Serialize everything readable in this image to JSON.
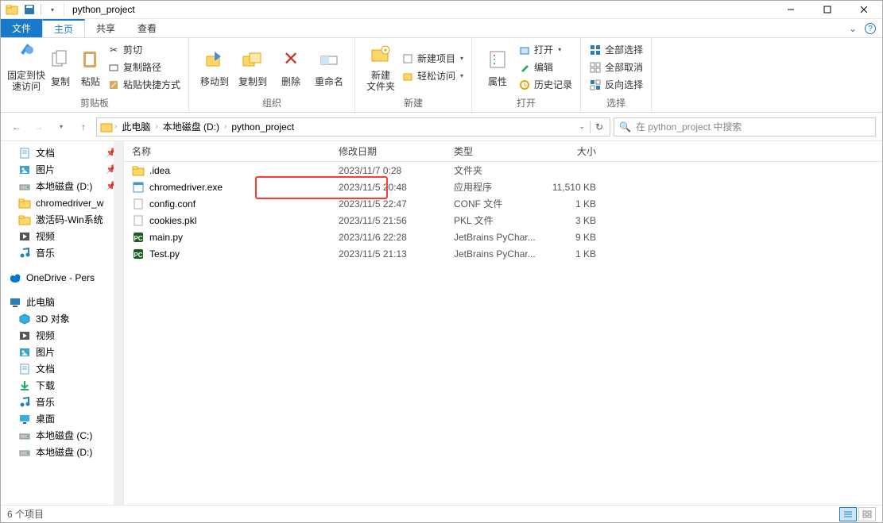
{
  "window": {
    "title": "python_project"
  },
  "qat": {
    "items": [
      "folder-icon",
      "save-icon",
      "divider",
      "chevron-down"
    ]
  },
  "tabs": {
    "file": "文件",
    "home": "主页",
    "share": "共享",
    "view": "查看"
  },
  "ribbon": {
    "clipboard": {
      "label": "剪贴板",
      "pin": "固定到快\n速访问",
      "copy": "复制",
      "paste": "粘贴",
      "cut": "剪切",
      "copy_path": "复制路径",
      "paste_shortcut": "粘贴快捷方式"
    },
    "organize": {
      "label": "组织",
      "move_to": "移动到",
      "copy_to": "复制到",
      "delete": "删除",
      "rename": "重命名"
    },
    "new": {
      "label": "新建",
      "new_folder": "新建\n文件夹",
      "new_item": "新建项目",
      "easy_access": "轻松访问"
    },
    "open": {
      "label": "打开",
      "properties": "属性",
      "open": "打开",
      "edit": "编辑",
      "history": "历史记录"
    },
    "select": {
      "label": "选择",
      "select_all": "全部选择",
      "select_none": "全部取消",
      "invert": "反向选择"
    }
  },
  "breadcrumb": [
    "此电脑",
    "本地磁盘 (D:)",
    "python_project"
  ],
  "addressbar": {
    "refresh": "refresh"
  },
  "search": {
    "placeholder": "在 python_project 中搜索"
  },
  "columns": {
    "name": "名称",
    "date": "修改日期",
    "type": "类型",
    "size": "大小"
  },
  "sidebar_quick": [
    {
      "icon": "doc",
      "label": "文档",
      "pin": true
    },
    {
      "icon": "pic",
      "label": "图片",
      "pin": true
    },
    {
      "icon": "drive",
      "label": "本地磁盘 (D:)",
      "pin": true
    },
    {
      "icon": "folder",
      "label": "chromedriver_w",
      "pin": false
    },
    {
      "icon": "folder",
      "label": "激活码-Win系统",
      "pin": false
    },
    {
      "icon": "video",
      "label": "视频",
      "pin": false
    },
    {
      "icon": "music",
      "label": "音乐",
      "pin": false
    }
  ],
  "sidebar_onedrive": {
    "label": "OneDrive - Pers"
  },
  "sidebar_pc": {
    "label": "此电脑"
  },
  "sidebar_pc_children": [
    {
      "icon": "3d",
      "label": "3D 对象"
    },
    {
      "icon": "video",
      "label": "视频"
    },
    {
      "icon": "pic",
      "label": "图片"
    },
    {
      "icon": "doc",
      "label": "文档"
    },
    {
      "icon": "download",
      "label": "下载"
    },
    {
      "icon": "music",
      "label": "音乐"
    },
    {
      "icon": "desktop",
      "label": "桌面"
    },
    {
      "icon": "drive",
      "label": "本地磁盘 (C:)"
    },
    {
      "icon": "drive",
      "label": "本地磁盘 (D:)"
    }
  ],
  "files": [
    {
      "icon": "folder",
      "name": ".idea",
      "date": "2023/11/7 0:28",
      "type": "文件夹",
      "size": "",
      "highlight": false
    },
    {
      "icon": "exe",
      "name": "chromedriver.exe",
      "date": "2023/11/5 20:48",
      "type": "应用程序",
      "size": "11,510 KB",
      "highlight": true
    },
    {
      "icon": "file",
      "name": "config.conf",
      "date": "2023/11/5 22:47",
      "type": "CONF 文件",
      "size": "1 KB",
      "highlight": false
    },
    {
      "icon": "file",
      "name": "cookies.pkl",
      "date": "2023/11/5 21:56",
      "type": "PKL 文件",
      "size": "3 KB",
      "highlight": false
    },
    {
      "icon": "py",
      "name": "main.py",
      "date": "2023/11/6 22:28",
      "type": "JetBrains PyChar...",
      "size": "9 KB",
      "highlight": false
    },
    {
      "icon": "py",
      "name": "Test.py",
      "date": "2023/11/5 21:13",
      "type": "JetBrains PyChar...",
      "size": "1 KB",
      "highlight": false
    }
  ],
  "status": {
    "count": "6 个项目"
  }
}
